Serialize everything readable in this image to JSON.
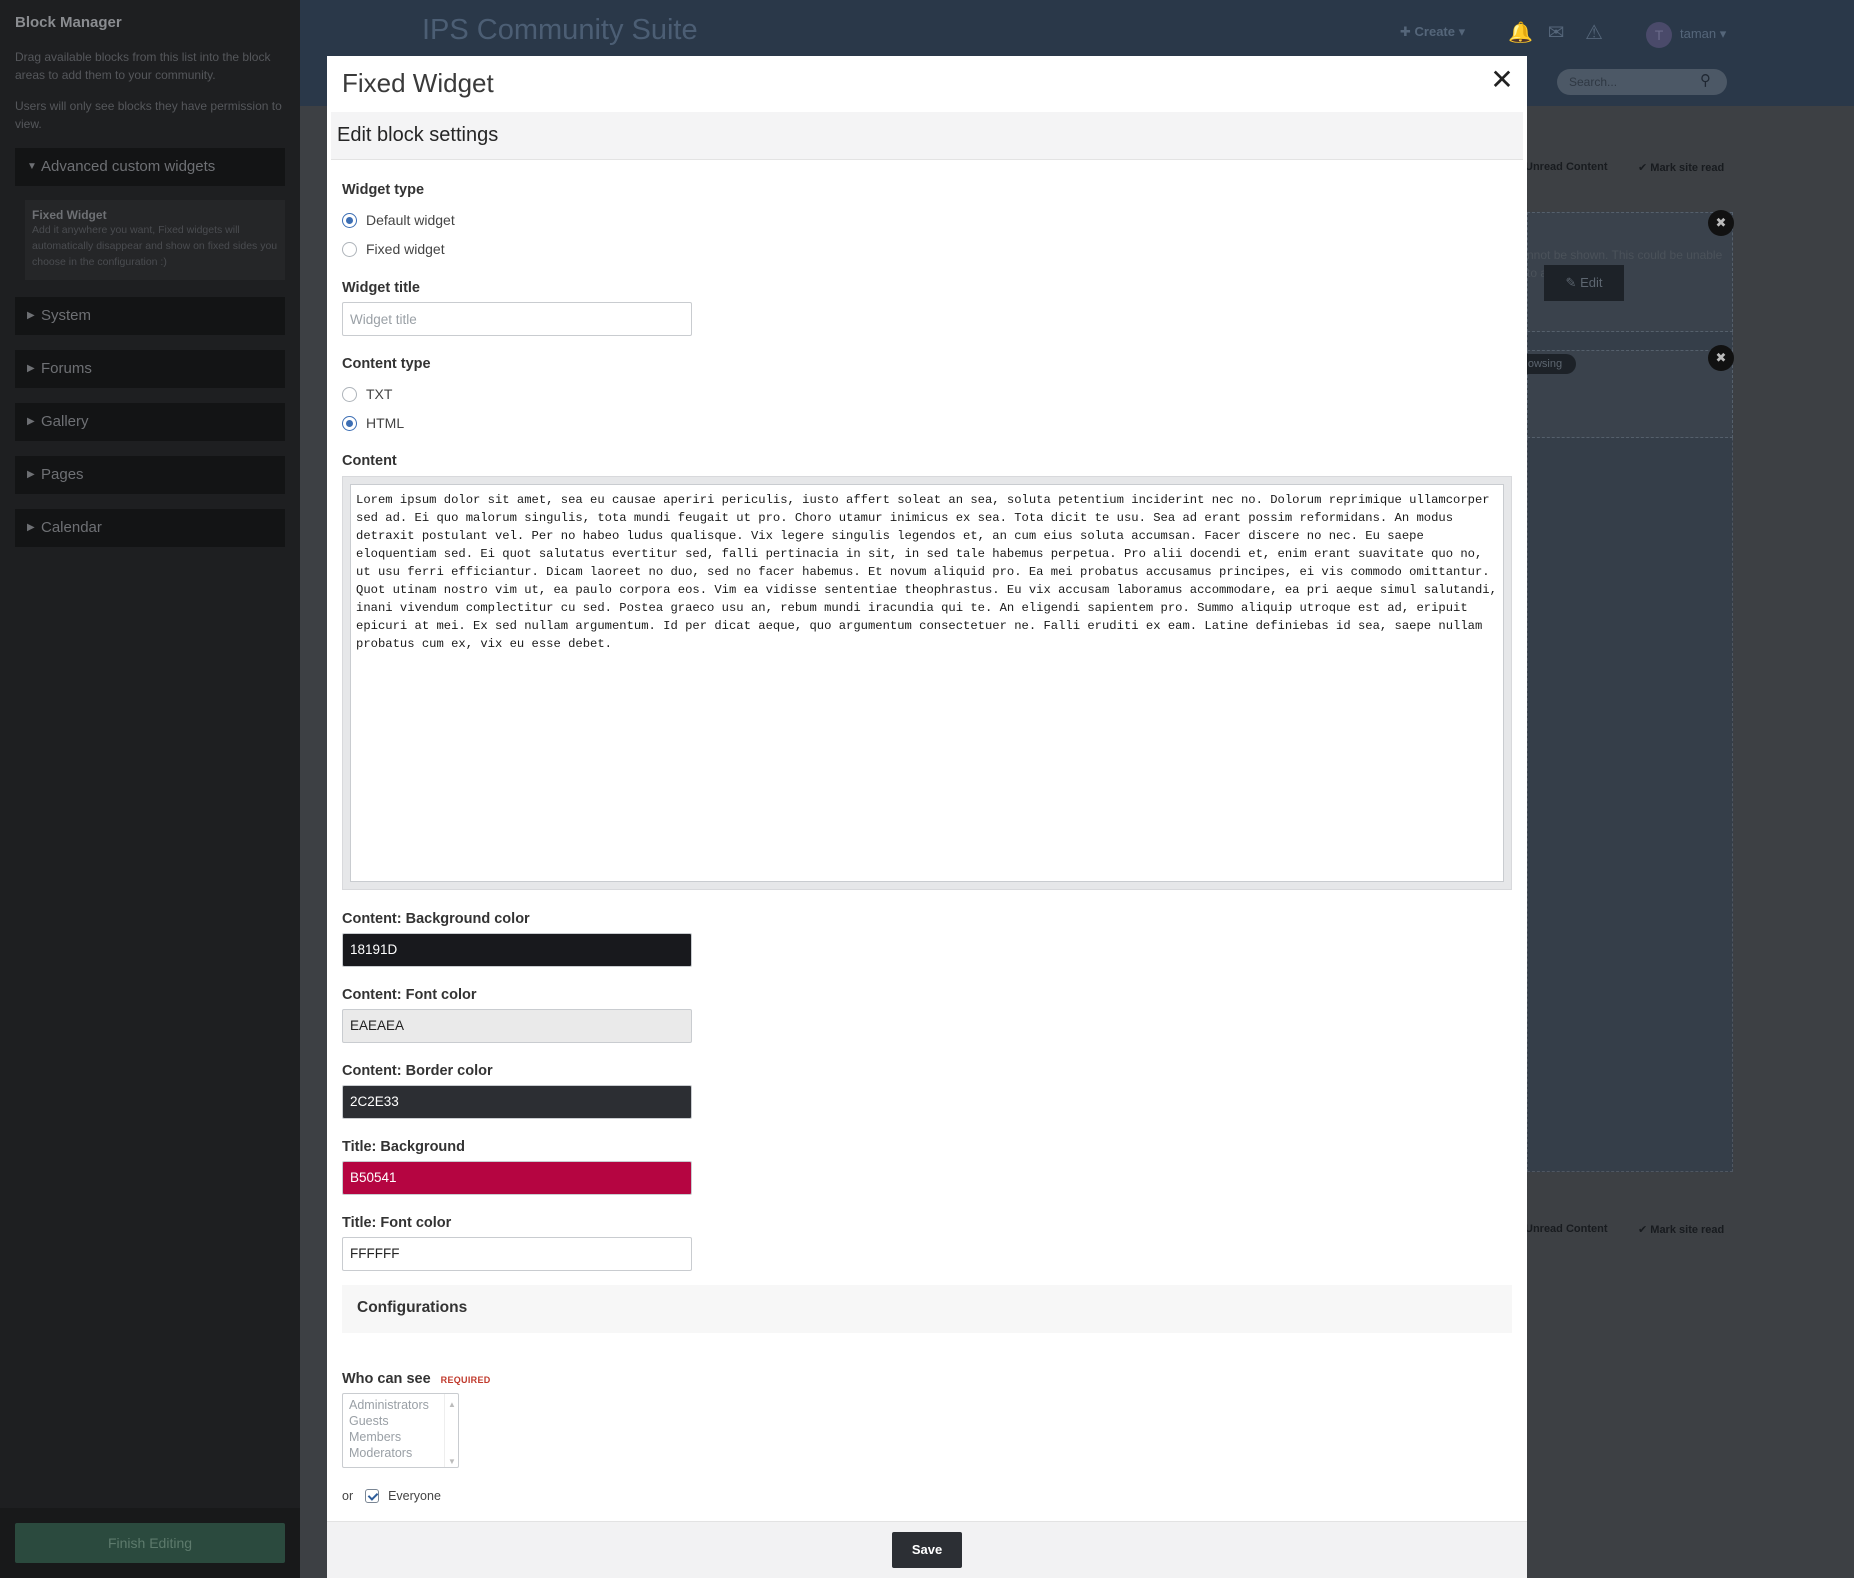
{
  "sidebar": {
    "title": "Block Manager",
    "desc1": "Drag available blocks from this list into the block areas to add them to your community.",
    "desc2": "Users will only see blocks they have permission to view.",
    "categories": [
      "Advanced custom widgets",
      "System",
      "Forums",
      "Gallery",
      "Pages",
      "Calendar"
    ],
    "widget": {
      "title": "Fixed Widget",
      "desc": "Add it anywhere you want, Fixed widgets will automatically disappear and show on fixed sides you choose in the configuration :)"
    },
    "finish_label": "Finish Editing"
  },
  "background": {
    "brand": "IPS Community Suite",
    "create_label": "Create",
    "user_initial": "T",
    "username": "taman",
    "search_placeholder": "Search...",
    "edit_label": "Edit",
    "pill_label": "owsing",
    "unread_label": "Unread Content",
    "mark_read_label": "Mark site read",
    "faded_text": "nnot be shown. This could be unable to after page"
  },
  "modal": {
    "title": "Fixed Widget",
    "section_title": "Edit block settings",
    "widget_type": {
      "label": "Widget type",
      "options": [
        "Default widget",
        "Fixed widget"
      ],
      "selected": "Default widget"
    },
    "widget_title": {
      "label": "Widget title",
      "placeholder": "Widget title",
      "value": ""
    },
    "content_type": {
      "label": "Content type",
      "options": [
        "TXT",
        "HTML"
      ],
      "selected": "HTML"
    },
    "content": {
      "label": "Content",
      "value": "Lorem ipsum dolor sit amet, sea eu causae aperiri periculis, iusto affert soleat an sea, soluta petentium inciderint nec no. Dolorum reprimique ullamcorper sed ad. Ei quo malorum singulis, tota mundi feugait ut pro. Choro utamur inimicus ex sea. Tota dicit te usu. Sea ad erant possim reformidans. An modus detraxit postulant vel. Per no habeo ludus qualisque. Vix legere singulis legendos et, an cum eius soluta accumsan. Facer discere no nec. Eu saepe eloquentiam sed. Ei quot salutatus evertitur sed, falli pertinacia in sit, in sed tale habemus perpetua. Pro alii docendi et, enim erant suavitate quo no, ut usu ferri efficiantur. Dicam laoreet no duo, sed no facer habemus. Et novum aliquid pro. Ea mei probatus accusamus principes, ei vis commodo omittantur. Quot utinam nostro vim ut, ea paulo corpora eos. Vim ea vidisse sententiae theophrastus. Eu vix accusam laboramus accommodare, ea pri aeque simul salutandi, inani vivendum complectitur cu sed. Postea graeco usu an, rebum mundi iracundia qui te. An eligendi sapientem pro. Summo aliquip utroque est ad, eripuit epicuri at mei. Ex sed nullam argumentum. Id per dicat aeque, quo argumentum consectetuer ne. Falli eruditi ex eam. Latine definiebas id sea, saepe nullam probatus cum ex, vix eu esse debet."
    },
    "colors": [
      {
        "label": "Content: Background color",
        "value": "18191D",
        "bg": "#18191D",
        "fg": "#FFFFFF"
      },
      {
        "label": "Content: Font color",
        "value": "EAEAEA",
        "bg": "#EAEAEA",
        "fg": "#222222"
      },
      {
        "label": "Content: Border color",
        "value": "2C2E33",
        "bg": "#2C2E33",
        "fg": "#FFFFFF"
      },
      {
        "label": "Title: Background",
        "value": "B50541",
        "bg": "#B50541",
        "fg": "#FFFFFF"
      },
      {
        "label": "Title: Font color",
        "value": "FFFFFF",
        "bg": "#FFFFFF",
        "fg": "#222222"
      }
    ],
    "configurations_title": "Configurations",
    "who_can_see": {
      "label": "Who can see",
      "required": "REQUIRED",
      "options": [
        "Administrators",
        "Guests",
        "Members",
        "Moderators"
      ],
      "or_label": "or",
      "everyone_label": "Everyone",
      "everyone_checked": true
    },
    "save_label": "Save"
  },
  "icons": {
    "close": "close-icon",
    "caret_down": "caret-down-icon",
    "caret_right": "caret-right-icon",
    "bell": "bell-icon",
    "envelope": "envelope-icon",
    "warning": "warning-icon",
    "search": "search-icon",
    "pencil": "pencil-icon",
    "checkmark": "check-icon"
  }
}
